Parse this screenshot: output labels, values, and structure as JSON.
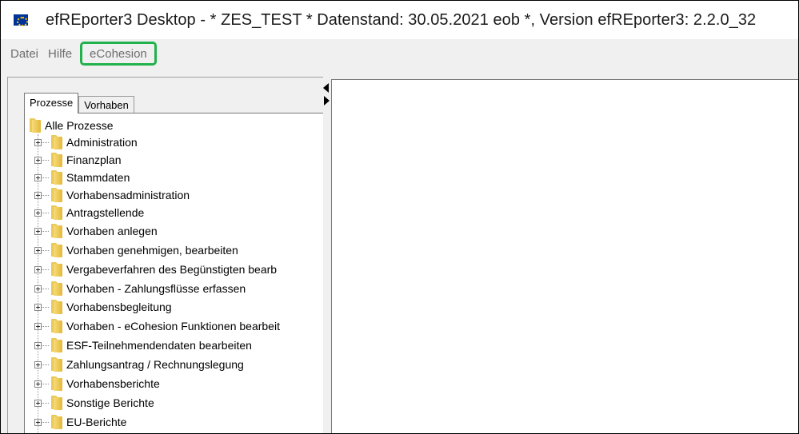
{
  "window": {
    "title": "efREporter3 Desktop - * ZES_TEST * Datenstand: 30.05.2021 eob *, Version efREporter3: 2.2.0_32",
    "icon": "eu-flag-icon"
  },
  "menu": {
    "items": [
      {
        "label": "Datei"
      },
      {
        "label": "Hilfe"
      },
      {
        "label": "eCohesion"
      }
    ],
    "highlight_color": "#22b24c"
  },
  "tabs": [
    {
      "label": "Prozesse",
      "active": true
    },
    {
      "label": "Vorhaben",
      "active": false
    }
  ],
  "tree": {
    "root": "Alle Prozesse",
    "items": [
      "Administration",
      "Finanzplan",
      "Stammdaten",
      "Vorhabensadministration",
      "Antragstellende",
      "Vorhaben anlegen",
      "Vorhaben genehmigen, bearbeiten",
      "Vergabeverfahren des Begünstigten bearb",
      "Vorhaben - Zahlungsflüsse erfassen",
      "Vorhabensbegleitung",
      "Vorhaben - eCohesion Funktionen bearbeit",
      "ESF-Teilnehmendendaten bearbeiten",
      "Zahlungsantrag / Rechnungslegung",
      "Vorhabensberichte",
      "Sonstige Berichte",
      "EU-Berichte"
    ]
  }
}
